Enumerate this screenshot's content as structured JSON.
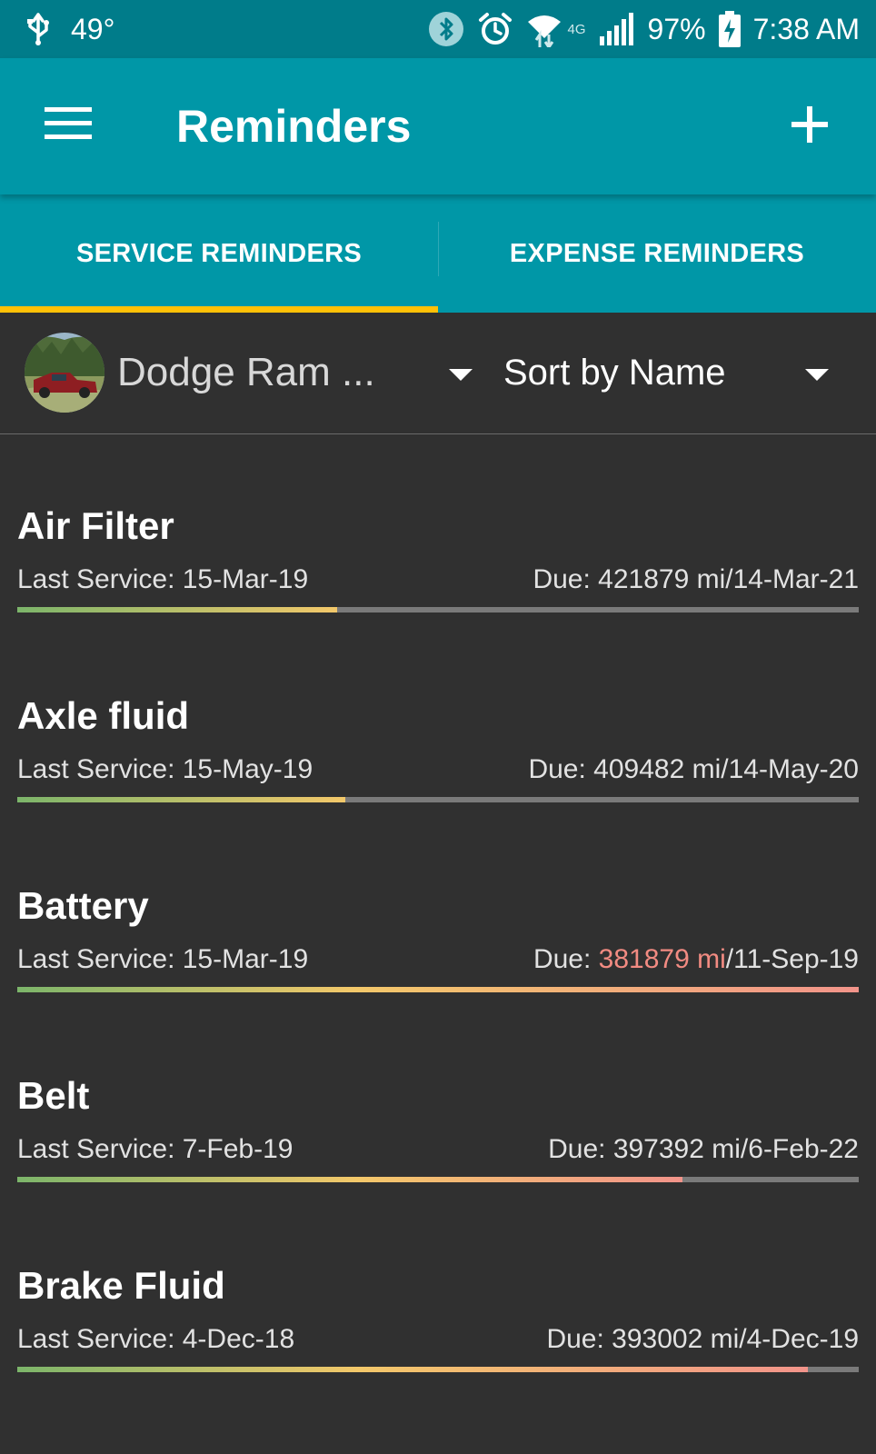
{
  "status_bar": {
    "temperature": "49°",
    "network": "4G",
    "battery": "97%",
    "time": "7:38 AM"
  },
  "app_bar": {
    "title": "Reminders"
  },
  "tabs": [
    {
      "label": "SERVICE REMINDERS",
      "active": true
    },
    {
      "label": "EXPENSE REMINDERS",
      "active": false
    }
  ],
  "filter": {
    "vehicle_name": "Dodge Ram ...",
    "sort_label": "Sort by Name"
  },
  "reminders": [
    {
      "name": "Air Filter",
      "last_service": "Last Service: 15-Mar-19",
      "due_prefix": "Due: ",
      "due_miles": "421879 mi",
      "due_suffix": "/14-Mar-21",
      "miles_overdue": false,
      "progress": 0.38
    },
    {
      "name": "Axle fluid",
      "last_service": "Last Service: 15-May-19",
      "due_prefix": "Due: ",
      "due_miles": "409482 mi",
      "due_suffix": "/14-May-20",
      "miles_overdue": false,
      "progress": 0.39
    },
    {
      "name": "Battery",
      "last_service": "Last Service: 15-Mar-19",
      "due_prefix": "Due: ",
      "due_miles": "381879 mi",
      "due_suffix": "/11-Sep-19",
      "miles_overdue": true,
      "progress": 1.0
    },
    {
      "name": "Belt",
      "last_service": "Last Service: 7-Feb-19",
      "due_prefix": "Due: ",
      "due_miles": "397392 mi",
      "due_suffix": "/6-Feb-22",
      "miles_overdue": false,
      "progress": 0.79
    },
    {
      "name": "Brake Fluid",
      "last_service": "Last Service: 4-Dec-18",
      "due_prefix": "Due: ",
      "due_miles": "393002 mi",
      "due_suffix": "/4-Dec-19",
      "miles_overdue": false,
      "progress": 0.94
    }
  ],
  "colors": {
    "status_bar": "#007c8a",
    "app_bar": "#0097a7",
    "tab_indicator": "#ffc107",
    "background": "#303030",
    "progress_start": "#7cb56a",
    "progress_mid": "#f3c86a",
    "progress_end": "#f2948a",
    "progress_track": "#7a7a7a",
    "overdue_text": "#f28b82"
  }
}
